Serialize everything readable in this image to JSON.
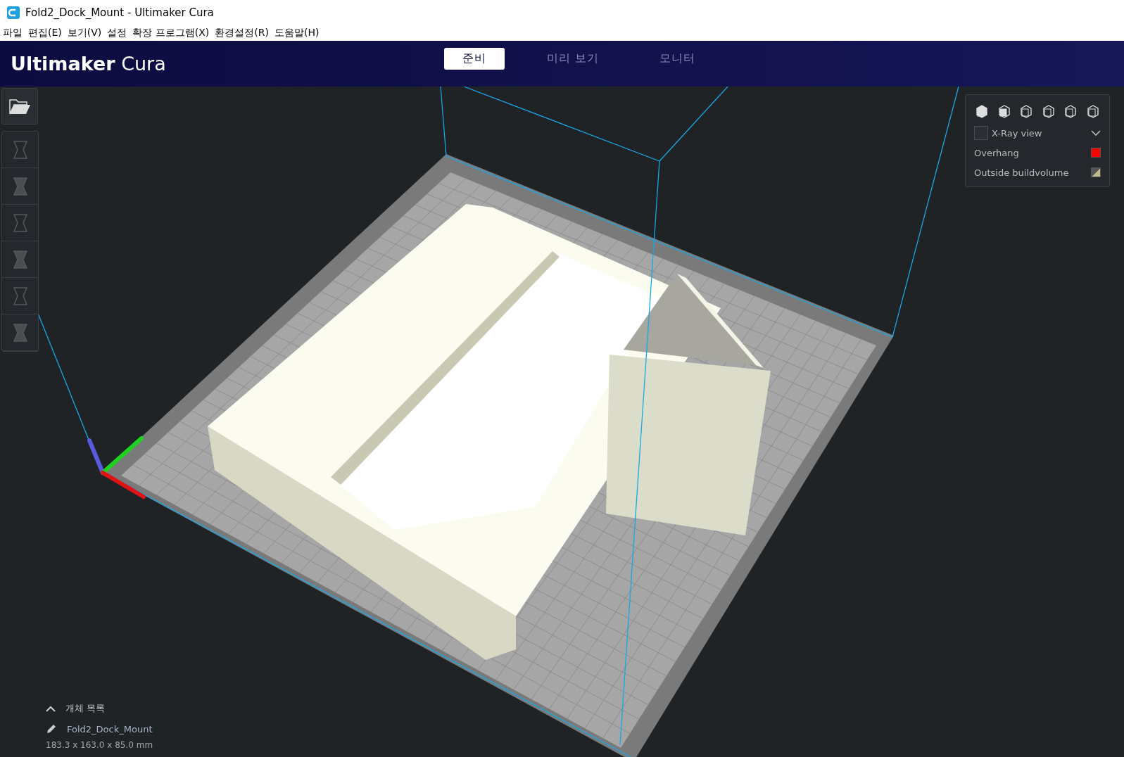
{
  "window": {
    "title": "Fold2_Dock_Mount - Ultimaker Cura"
  },
  "menu": [
    "파일",
    "편집(E)",
    "보기(V)",
    "설정",
    "확장 프로그램(X)",
    "환경설정(R)",
    "도움말(H)"
  ],
  "header": {
    "brand": "Ultimaker",
    "product": "Cura"
  },
  "tabs": [
    {
      "label": "준비",
      "selected": true
    },
    {
      "label": "미리 보기",
      "selected": false
    },
    {
      "label": "모니터",
      "selected": false
    }
  ],
  "view_panel": {
    "xray": {
      "label": "X-Ray view",
      "checked": false
    },
    "legend": [
      {
        "label": "Overhang",
        "kind": "solid",
        "color": "#ff0000"
      },
      {
        "label": "Outside buildvolume",
        "kind": "split",
        "color": "#bdb98a"
      }
    ]
  },
  "object_list": {
    "title": "개체 목록",
    "expanded": true,
    "object": "Fold2_Dock_Mount",
    "dimensions": "183.3 x 163.0 x 85.0 mm"
  }
}
